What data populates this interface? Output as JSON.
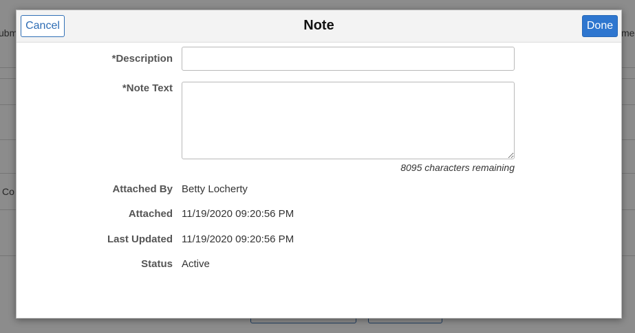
{
  "background": {
    "left_fragments": [
      "ubm",
      "Co"
    ],
    "right_fragments": [
      "me"
    ]
  },
  "modal": {
    "title": "Note",
    "cancel_label": "Cancel",
    "done_label": "Done"
  },
  "form": {
    "description": {
      "label": "*Description",
      "value": "",
      "placeholder": ""
    },
    "note_text": {
      "label": "*Note Text",
      "value": "",
      "remaining": "8095 characters remaining"
    },
    "attached_by": {
      "label": "Attached By",
      "value": "Betty Locherty"
    },
    "attached": {
      "label": "Attached",
      "value": "11/19/2020 09:20:56 PM"
    },
    "last_updated": {
      "label": "Last Updated",
      "value": "11/19/2020 09:20:56 PM"
    },
    "status": {
      "label": "Status",
      "value": "Active"
    }
  }
}
